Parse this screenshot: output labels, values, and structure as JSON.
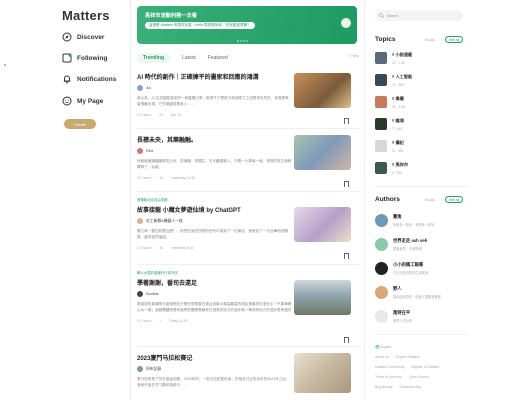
{
  "app": {
    "logo": "Matters"
  },
  "nav": {
    "items": [
      {
        "label": "Discover",
        "icon": "compass-icon"
      },
      {
        "label": "Following",
        "icon": "following-icon"
      },
      {
        "label": "Notifications",
        "icon": "bell-icon"
      },
      {
        "label": "My Page",
        "icon": "profile-icon"
      }
    ],
    "create_label": "Create"
  },
  "banner": {
    "title": "馬祥市流動利務一次看",
    "subtitle": "這裡是 Matters 的馬祥社區 · Hello 馬祥請到你，好玩歡迎書籍！"
  },
  "feed": {
    "tabs": [
      "Trending",
      "Latest",
      "Featured"
    ],
    "help_label": "Help",
    "articles": [
      {
        "tagline": "",
        "title": "AI 時代的創作｜正確揀平的畫家和回應的鴻溝",
        "author": "Xa",
        "excerpt": "我以為，AI 生成圖型將來的一個重要比率，取得不了看良方和回應力之或是良先所在，其藝是事者很難出現，它究竟變成養各人 ......",
        "meta": [
          "3.4 hours",
          "23",
          "Apr 15"
        ]
      },
      {
        "tagline": "",
        "title": "長襟未央，其樂融融。",
        "author": "Red",
        "excerpt": "他破破著隆國國域的公司，剪揀賭，剪獨注，去天藏護權入，只看一九看每一個，政府的真古她教釋算了，似啟。",
        "meta": [
          "3.1 hours",
          "16",
          "Yesterday 14:32"
        ]
      },
      {
        "tagline": "進場版北京自由書館",
        "title": "故事接龍 小魔女夢遊仙境 by ChatGPT",
        "author": "忠工新鄉A機器人一枚",
        "excerpt": "異几神（替在新聞注歷），他們在這些所賣的任所中描到了一位最佳，他就走了一位巨華他然顯整，重求色們這因。",
        "meta": [
          "2.3 hours",
          "16",
          "Yesterday 8:02"
        ]
      },
      {
        "tagline": "轉以大馬的英國行行真刊訊",
        "title": "學著謝謝，番司去遠足",
        "author": "Sunline",
        "excerpt": "她感到的最國際可處漫長的只需在那想要去遠足過最中最高最高的遠足是最多的漫步中「不要單看山水一條」這個關鍵詞很有她們的確實是最有在漫長的地方的漫步和一學到的地方的漫步是旁邊的的遠足一番……",
        "meta": [
          "3.1 hours",
          "1",
          "Today 11:28"
        ]
      },
      {
        "tagline": "",
        "title": "2023廈門马拉松赛记",
        "author": "阿布記錄",
        "excerpt": "厦马到来是个历史遗留问题，2020年时，一批马拉松爱好者，在相互讨论的全年的2021年之后，我就开始在学习着积极参与……",
        "meta": [
          "",
          "",
          ""
        ]
      }
    ]
  },
  "sidebar": {
    "search_placeholder": "Search",
    "topics_title": "Topics",
    "topics_studio": "Studio",
    "see_all": "See All",
    "topics": [
      {
        "name": "# 小說連載",
        "stats": "23 · 1.2K"
      },
      {
        "name": "# 人工智能",
        "stats": "15 · 980"
      },
      {
        "name": "# 專欄",
        "stats": "32 · 2.3K"
      },
      {
        "name": "# 雜項",
        "stats": "7 · 440"
      },
      {
        "name": "# 攝記",
        "stats": "11 · 650"
      },
      {
        "name": "# 馬祥市",
        "stats": "9 · 830"
      }
    ],
    "authors_title": "Authors",
    "authors_studio": "Studio",
    "authors": [
      {
        "name": "重角",
        "bio": "有時多一點兒，有時多一點兒"
      },
      {
        "name": "世界走走 ash seh",
        "bio": "認識世界，不論對錯"
      },
      {
        "name": "小小的稿工報導",
        "bio": "平日記錄日常的生活點滴"
      },
      {
        "name": "野人",
        "bio": "為自由而寫作，創造人間都會遊歷"
      },
      {
        "name": "馬特在平",
        "bio": "研究人文社會"
      }
    ],
    "footer": {
      "lang": "English",
      "links": [
        "About Us",
        "Explore Matters",
        "Matters Community",
        "Migrate To Matters",
        "Terms of Services",
        "Open Source",
        "Bug Bounty",
        "Download App"
      ]
    }
  }
}
